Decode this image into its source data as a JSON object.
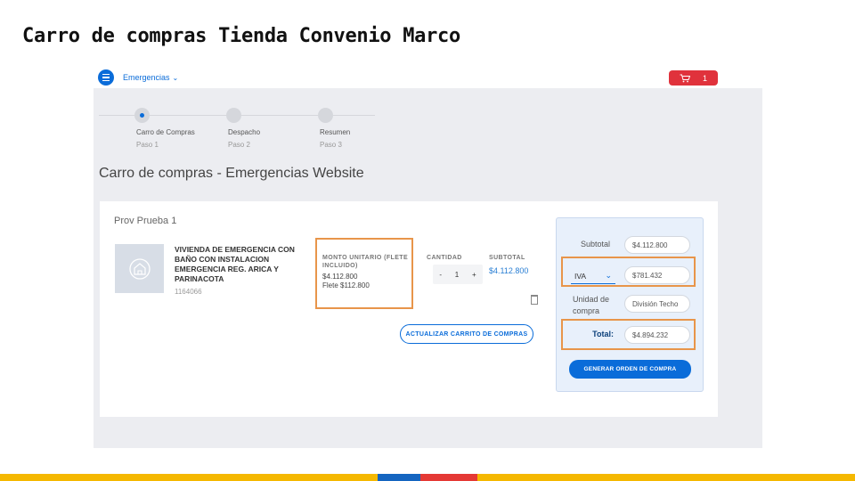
{
  "slide_title": "Carro de compras Tienda Convenio Marco",
  "topbar": {
    "category": "Emergencias",
    "cart_count": "1"
  },
  "stepper": [
    {
      "name": "Carro de Compras",
      "sub": "Paso 1"
    },
    {
      "name": "Despacho",
      "sub": "Paso 2"
    },
    {
      "name": "Resumen",
      "sub": "Paso 3"
    }
  ],
  "page_heading": "Carro de compras - Emergencias Website",
  "cart": {
    "provider": "Prov Prueba 1",
    "product_name": "VIVIENDA DE EMERGENCIA CON BAÑO CON INSTALACION EMERGENCIA REG. ARICA Y PARINACOTA",
    "product_code": "1164066",
    "unit_price_label": "MONTO UNITARIO (FLETE INCLUIDO)",
    "unit_price": "$4.112.800",
    "freight": "Flete $112.800",
    "quantity_label": "CANTIDAD",
    "quantity": "1",
    "minus": "-",
    "plus": "+",
    "subtotal_label": "SUBTOTAL",
    "subtotal": "$4.112.800",
    "update_button": "ACTUALIZAR CARRITO DE COMPRAS"
  },
  "summary": {
    "subtotal_label": "Subtotal",
    "subtotal_value": "$4.112.800",
    "tax_option": "IVA",
    "tax_value": "$781.432",
    "unit_label": "Unidad de compra",
    "unit_value": "División Techo",
    "total_label": "Total:",
    "total_value": "$4.894.232",
    "generate_button": "GENERAR ORDEN DE COMPRA"
  },
  "colors": {
    "accent": "#0a6cd9",
    "cart": "#e0323c",
    "highlight": "#e8954a",
    "stripe_yellow": "#f5b800",
    "stripe_blue": "#1565c0",
    "stripe_red": "#e53935"
  }
}
